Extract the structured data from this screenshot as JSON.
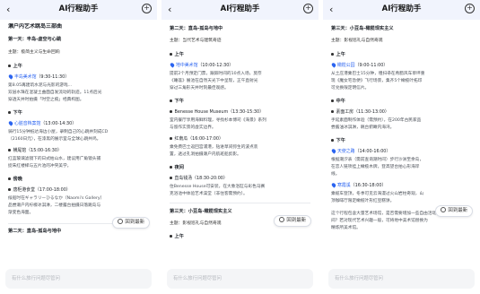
{
  "app": {
    "title": "AI行程助手",
    "back_icon": "chevron-left-icon",
    "new_chat_icon": "plus-circle-icon",
    "back_to_latest": "回到最新",
    "input_placeholder": "有什么旅行问题尽管问"
  },
  "panels": [
    {
      "lines": [
        {
          "kind": "title",
          "text": "濑户内艺术跳岛三部曲"
        },
        {
          "kind": "section",
          "text": "第一天：丰岛-虚空与心跳"
        },
        {
          "kind": "theme",
          "text": "主题：极简主义与生命回响"
        },
        {
          "kind": "period",
          "text": "上午"
        },
        {
          "kind": "venue",
          "name": "丰岛美术馆",
          "time": "（9:30-11:30）"
        },
        {
          "kind": "body",
          "text": "第8.05再建筑水泥与光影的游戏..."
        },
        {
          "kind": "body",
          "text": "双层水珠在混凝土曲面自发流动的轨迹。11点后光"
        },
        {
          "kind": "body",
          "text": "穿透天井时拍摄「时空之痕」经典构图。"
        },
        {
          "kind": "period",
          "text": "下午"
        },
        {
          "kind": "venue",
          "name": "心脏音档案馆",
          "time": "（13:00-14:30）"
        },
        {
          "kind": "body",
          "text": "骑行15分钟抵达海边小屋，录制自己的心跳并刻成CD"
        },
        {
          "kind": "body",
          "text": "（2160日元），在漆黑的展示室与全球心跳共鸣。"
        },
        {
          "kind": "venue",
          "name": "横尾馆",
          "time": "（15:00-16:30）"
        },
        {
          "kind": "body",
          "text": "红蓝玻璃滤镜下的日式枯山水，建议用广角镜头捕"
        },
        {
          "kind": "body",
          "text": "捉朱红楼梯与五片池的冲突美学。"
        },
        {
          "kind": "period",
          "text": "傍晚"
        },
        {
          "kind": "venue",
          "name": "唐柜港食堂",
          "time": "（17:00-18:00）"
        },
        {
          "kind": "body",
          "text": "候船时在ギャラリーひるなか（Naomi's Gallery）"
        },
        {
          "kind": "body",
          "text": "品尝濑户内柠檬冰淇淋，二楼露台拍摄日落跳岛与"
        },
        {
          "kind": "body",
          "text": "渐变色海面。"
        },
        {
          "kind": "section",
          "text": "第二天：直岛-孤岛与地中"
        }
      ]
    },
    {
      "lines": [
        {
          "kind": "section",
          "text": "第二天：直岛-孤岛与地中"
        },
        {
          "kind": "theme",
          "text": "主题：当代艺术与建筑奇迹"
        },
        {
          "kind": "period",
          "text": "上午"
        },
        {
          "kind": "venue",
          "name": "地中美术馆",
          "time": "（10:00-12:30）"
        },
        {
          "kind": "body",
          "text": "提前2个月预定门票，跟踪时间的10点入场，莫奈"
        },
        {
          "kind": "body",
          "text": "《睡莲》展池在自然天光下中呈现，正午直射光"
        },
        {
          "kind": "body",
          "text": "穿过三角形天井时刻最佳观感。"
        },
        {
          "kind": "period",
          "text": "下午"
        },
        {
          "kind": "venue",
          "name": "Benesse House Museum",
          "time": "（13:30-15:30）"
        },
        {
          "kind": "body",
          "text": "室内餐厅享用海鲜料理，寻找杉本博司《海景》系列"
        },
        {
          "kind": "body",
          "text": "与留作实景的虚实边界。"
        },
        {
          "kind": "venue",
          "name": "红南瓜",
          "time": "（16:00-17:00）"
        },
        {
          "kind": "body",
          "text": "乘免费巴士返回宫浦港，钻进草间弥生的波点装"
        },
        {
          "kind": "body",
          "text": "置，透过孔洞拍摄濑户内航班船剪影。"
        },
        {
          "kind": "period",
          "text": "夜间"
        },
        {
          "kind": "venue",
          "name": "直岛钱汤",
          "time": "（18:30-20:00）"
        },
        {
          "kind": "body",
          "text": "住Benesse House可安装，在大象浴缸与彩色马赛"
        },
        {
          "kind": "body",
          "text": "克浴池中体验艺术澡堂（非住客需预约）。"
        },
        {
          "kind": "section",
          "text": "第三天：小豆岛-橄榄现实主义"
        },
        {
          "kind": "theme",
          "text": "主题：影视巡礼与自然奇观"
        },
        {
          "kind": "period",
          "text": "上午"
        }
      ]
    },
    {
      "lines": [
        {
          "kind": "section",
          "text": "第三天：小豆岛-橄榄现实主义"
        },
        {
          "kind": "theme",
          "text": "主题：影视巡礼与自然奇观"
        },
        {
          "kind": "period",
          "text": "上午"
        },
        {
          "kind": "venue",
          "name": "橄榄公园",
          "time": "（9:00-11:00）"
        },
        {
          "kind": "body",
          "text": "从土庄港乘巴士15分钟，租扫帚在希腊风车草坪重"
        },
        {
          "kind": "body",
          "text": "现《魔女宅急便》飞行场景，集齐5个橄榄叶拓印"
        },
        {
          "kind": "body",
          "text": "可兑换限定明信片。"
        },
        {
          "kind": "period",
          "text": "中午"
        },
        {
          "kind": "venue",
          "name": "素面工房",
          "time": "（11:30-13:00）"
        },
        {
          "kind": "body",
          "text": "手延素面制作体验（需预约），在200年古民家品"
        },
        {
          "kind": "body",
          "text": "尝酱油冰淇淋，眺台俯瞰内海湾。"
        },
        {
          "kind": "period",
          "text": "下午"
        },
        {
          "kind": "venue",
          "name": "天使之路",
          "time": "（14:00-16:00）"
        },
        {
          "kind": "body",
          "text": "根据潮汐表（需前查询潮时间）步行沙洲至余岛，"
        },
        {
          "kind": "body",
          "text": "在恋人链项挂上橄榄木牌，登高望台拍心形海岸"
        },
        {
          "kind": "body",
          "text": "线。"
        },
        {
          "kind": "venue",
          "name": "寒霞溪",
          "time": "（16:30-18:00）"
        },
        {
          "kind": "body",
          "text": "乘缆车登顶，冬季可见云海漫过火山岩柱奇观，山"
        },
        {
          "kind": "body",
          "text": "顶咖啡厅限定橄榄叶形红豆糕饼。"
        },
        {
          "kind": "body",
          "text": "这个行程包含大量艺术场馆，是否需要增加一些自由活动时"
        },
        {
          "kind": "body",
          "text": "间？若对现代艺术兴趣一般，可将地中美术馆替换为"
        },
        {
          "kind": "body",
          "text": "精炼所美术馆。"
        }
      ]
    }
  ]
}
